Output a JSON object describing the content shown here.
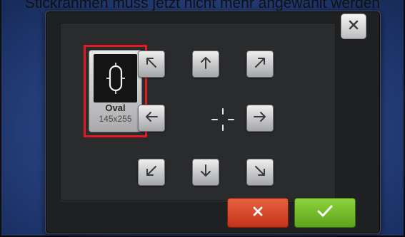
{
  "banner": {
    "text": "Stickrahmen muss jetzt nicht mehr angewählt werden"
  },
  "dialog": {
    "close_icon": "close-icon",
    "hoop": {
      "name": "Oval",
      "size": "145x255",
      "selected": true,
      "highlight_color": "#e21a22"
    },
    "move_buttons": [
      {
        "id": "up-left",
        "icon": "arrow-up-left-icon"
      },
      {
        "id": "up",
        "icon": "arrow-up-icon"
      },
      {
        "id": "up-right",
        "icon": "arrow-up-right-icon"
      },
      {
        "id": "left",
        "icon": "arrow-left-icon"
      },
      {
        "id": "right",
        "icon": "arrow-right-icon"
      },
      {
        "id": "down-left",
        "icon": "arrow-down-left-icon"
      },
      {
        "id": "down",
        "icon": "arrow-down-icon"
      },
      {
        "id": "down-right",
        "icon": "arrow-down-right-icon"
      }
    ],
    "center_icon": "crosshair-icon",
    "cancel_icon": "x-icon",
    "confirm_icon": "checkmark-icon",
    "colors": {
      "cancel": "#d44a2c",
      "confirm": "#76bf2c"
    }
  }
}
